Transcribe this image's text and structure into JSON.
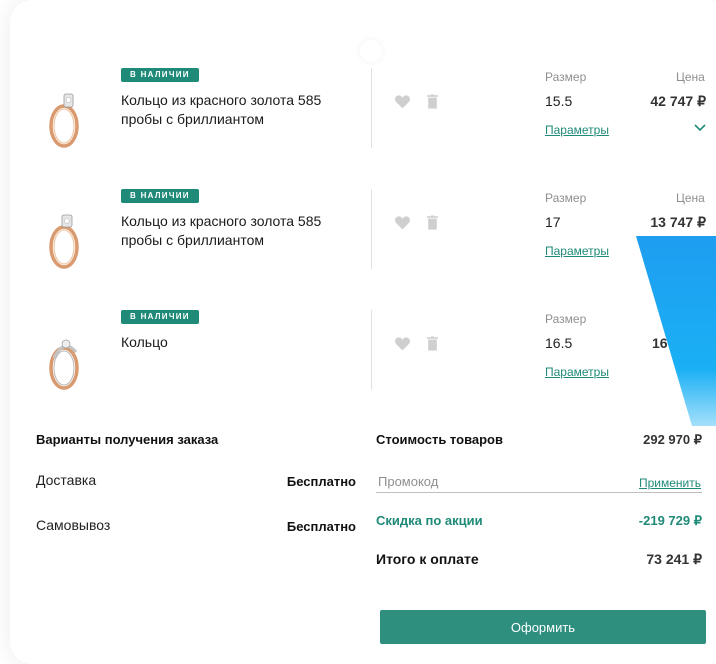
{
  "colors": {
    "accent": "#1f8a78",
    "button": "#2f8f7f",
    "decor_stripe": "#1e9df0"
  },
  "labels": {
    "size": "Размер",
    "price": "Цена",
    "params": "Параметры"
  },
  "cart": {
    "items": [
      {
        "status": "в наличии",
        "name": "Кольцо из красного золота 585 пробы с бриллиантом",
        "size": "15.5",
        "price": "42 747 ₽",
        "show_price_label": true,
        "show_chevron": true
      },
      {
        "status": "в наличии",
        "name": "Кольцо из красного золота 585 пробы с бриллиантом",
        "size": "17",
        "price": "13 747 ₽",
        "show_price_label": true,
        "show_chevron": false
      },
      {
        "status": "в наличии",
        "name": "Кольцо",
        "size": "16.5",
        "price": "16 7",
        "show_price_label": false,
        "show_chevron": false
      }
    ]
  },
  "delivery": {
    "title": "Варианты получения заказа",
    "options": [
      {
        "label": "Доставка",
        "value": "Бесплатно"
      },
      {
        "label": "Самовывоз",
        "value": "Бесплатно"
      }
    ]
  },
  "summary": {
    "goods_label": "Стоимость товаров",
    "goods_value": "292 970 ₽",
    "promo_placeholder": "Промокод",
    "apply_label": "Применить",
    "discount_label": "Скидка по акции",
    "discount_value": "-219 729 ₽",
    "total_label": "Итого к оплате",
    "total_value": "73 241 ₽",
    "submit_label": "Оформить"
  },
  "icons": {
    "heart": "heart-icon",
    "trash": "trash-icon",
    "chevron": "chevron-down-icon",
    "ring": "ring-image"
  }
}
